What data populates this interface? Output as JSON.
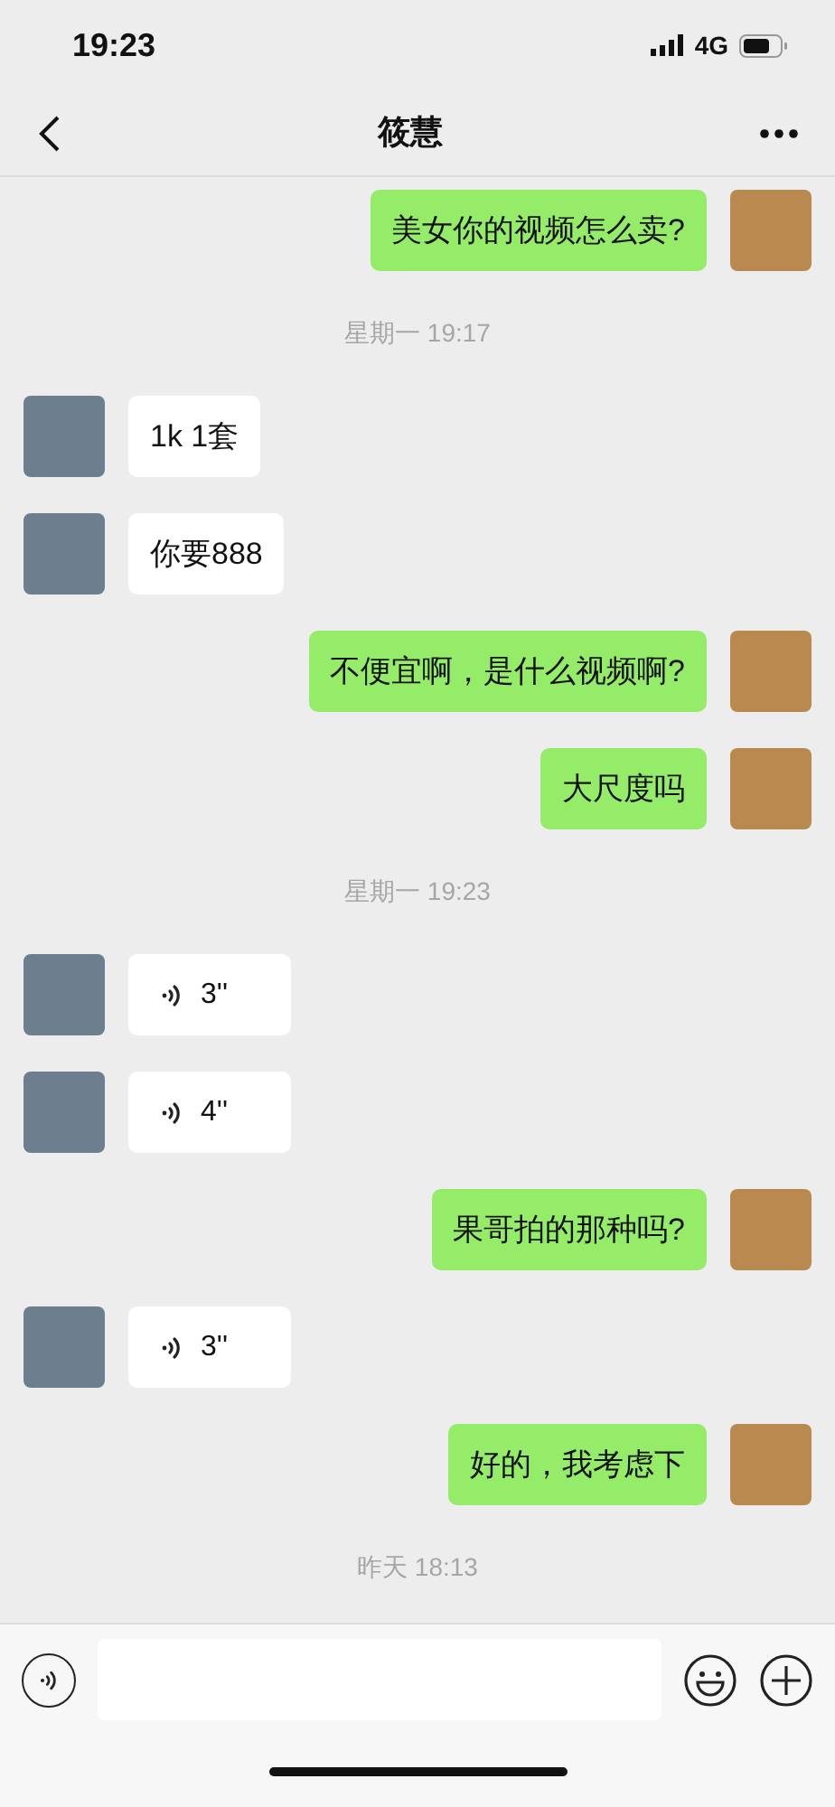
{
  "status_bar": {
    "time": "19:23",
    "network": "4G"
  },
  "header": {
    "title": "筱慧"
  },
  "messages": [
    {
      "kind": "text",
      "outgoing": true,
      "text": "美女你的视频怎么卖?"
    },
    {
      "kind": "time",
      "text": "星期一 19:17"
    },
    {
      "kind": "text",
      "outgoing": false,
      "text": "1k 1套"
    },
    {
      "kind": "text",
      "outgoing": false,
      "text": "你要888"
    },
    {
      "kind": "text",
      "outgoing": true,
      "text": "不便宜啊，是什么视频啊?"
    },
    {
      "kind": "text",
      "outgoing": true,
      "text": "大尺度吗"
    },
    {
      "kind": "time",
      "text": "星期一 19:23"
    },
    {
      "kind": "voice",
      "outgoing": false,
      "text": "3''"
    },
    {
      "kind": "voice",
      "outgoing": false,
      "text": "4''"
    },
    {
      "kind": "text",
      "outgoing": true,
      "text": "果哥拍的那种吗?"
    },
    {
      "kind": "voice",
      "outgoing": false,
      "text": "3''"
    },
    {
      "kind": "text",
      "outgoing": true,
      "text": "好的，我考虑下"
    },
    {
      "kind": "time",
      "text": "昨天 18:13"
    }
  ]
}
